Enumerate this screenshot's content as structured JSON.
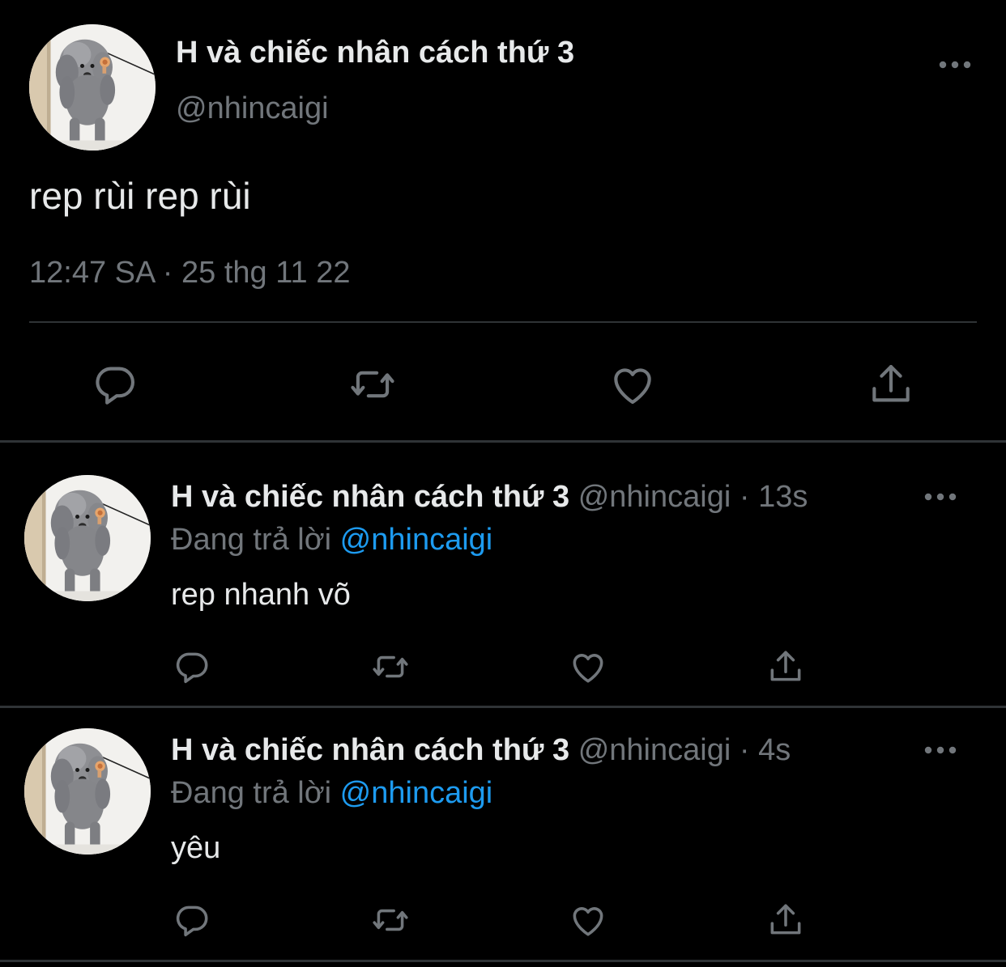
{
  "colors": {
    "background": "#000000",
    "text_primary": "#e7e9ea",
    "text_secondary": "#71767b",
    "accent": "#1d9bf0",
    "divider": "#2f3336"
  },
  "main_tweet": {
    "author_name": "H và chiếc nhân cách thứ 3",
    "author_handle": "@nhincaigi",
    "text": "rep rùi rep rùi",
    "timestamp": "12:47 SA · 25 thg 11 22",
    "avatar_icon": "poodle-avatar",
    "more_icon": "more-horizontal-icon",
    "actions": [
      {
        "name": "reply",
        "icon": "reply-icon"
      },
      {
        "name": "retweet",
        "icon": "retweet-icon"
      },
      {
        "name": "like",
        "icon": "heart-icon"
      },
      {
        "name": "share",
        "icon": "share-icon"
      }
    ]
  },
  "replies": [
    {
      "author_name": "H và chiếc nhân cách thứ 3",
      "author_handle": "@nhincaigi",
      "separator": "·",
      "time_ago": "13s",
      "replying_prefix": "Đang trả lời",
      "replying_to": "@nhincaigi",
      "text": "rep nhanh võ"
    },
    {
      "author_name": "H và chiếc nhân cách thứ 3",
      "author_handle": "@nhincaigi",
      "separator": "·",
      "time_ago": "4s",
      "replying_prefix": "Đang trả lời",
      "replying_to": "@nhincaigi",
      "text": "yêu"
    }
  ]
}
